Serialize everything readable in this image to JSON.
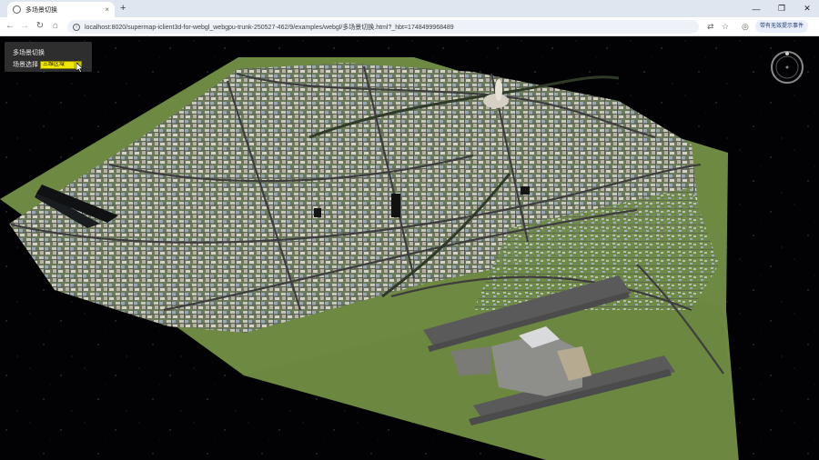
{
  "browser": {
    "tab_title": "多场景切换",
    "tab_close": "×",
    "new_tab": "+",
    "window_controls": [
      "—",
      "❐",
      "✕"
    ],
    "url": "localhost:8020/supermap-iclient3d-for-webgl_webgpu-trunk-250527-462/9/examples/webgl/多场景切换.html?_hbt=1748499968489",
    "profile_label": "带有无效提示事件"
  },
  "panel": {
    "title": "多场景切换",
    "select_label": "场景选择",
    "selected_value": "三维区域",
    "arrow": "▾"
  },
  "colors": {
    "ground": "#6e8a42",
    "road": "#4a4a4a",
    "runway": "#5b5b5b",
    "select_bg": "#f2e700"
  }
}
